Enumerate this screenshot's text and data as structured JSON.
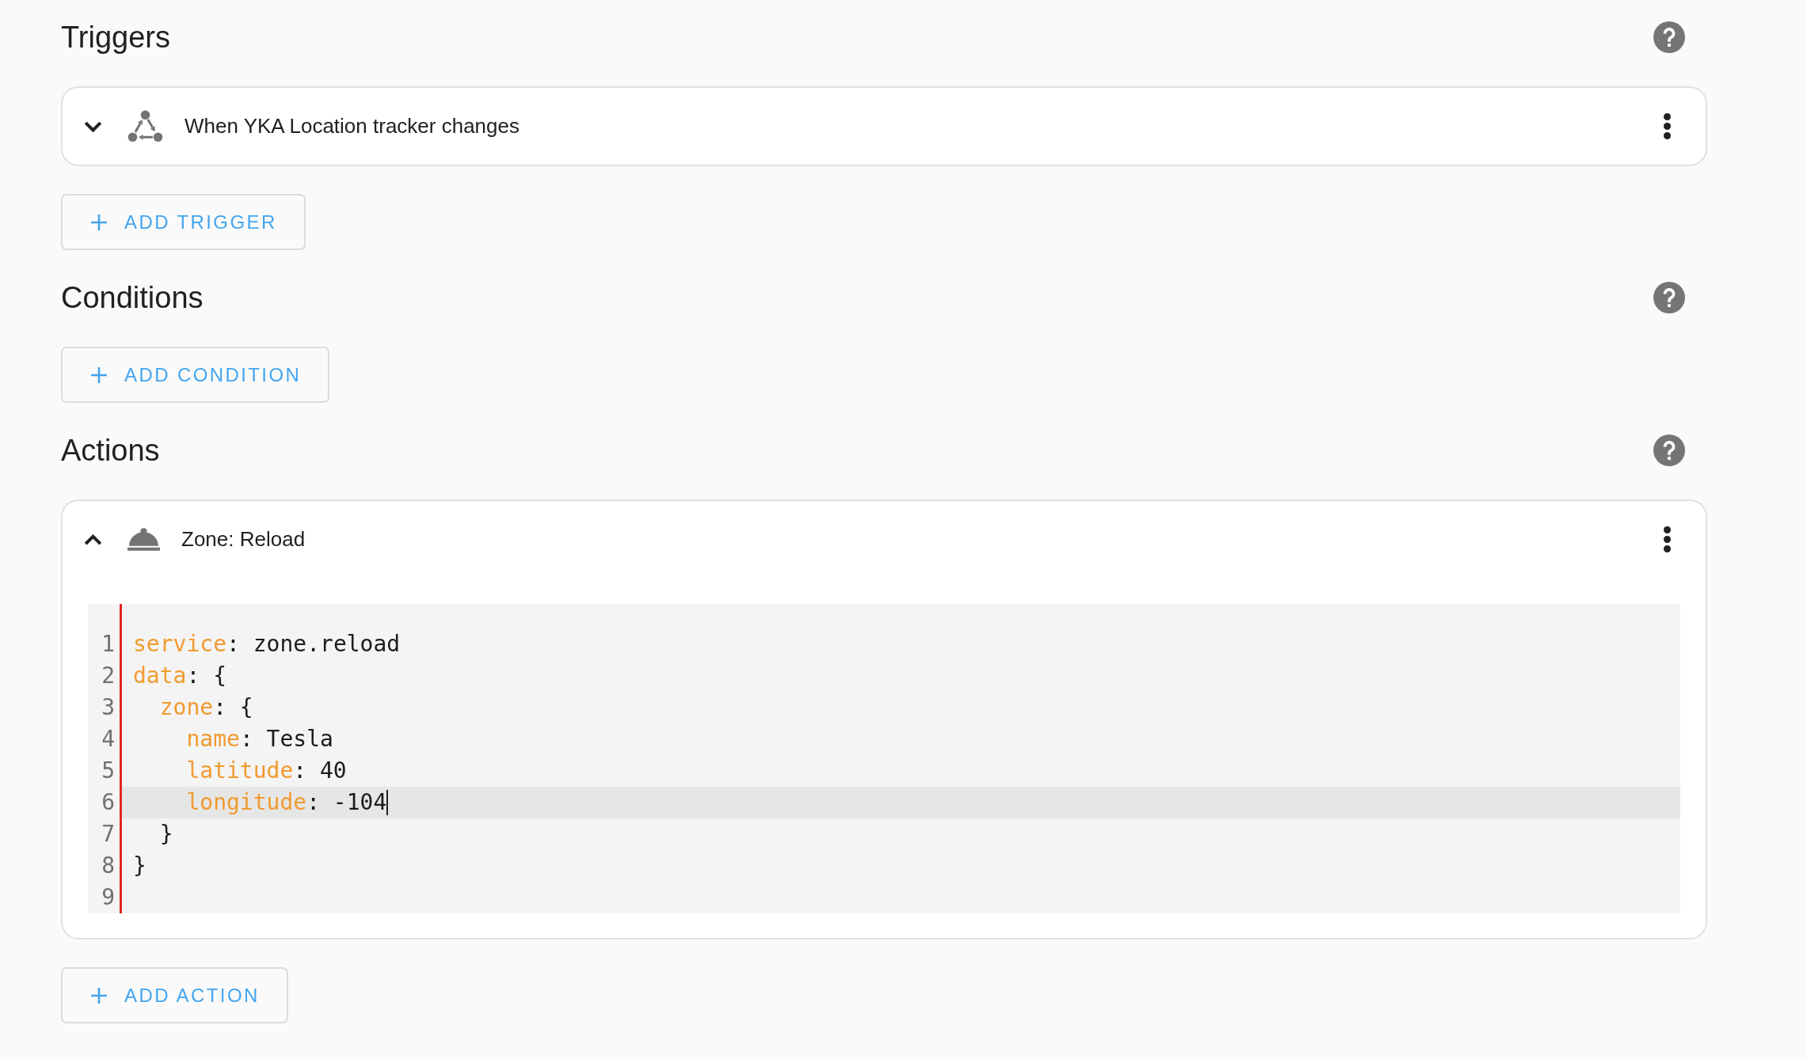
{
  "sections": [
    {
      "title": "Triggers",
      "items": [
        {
          "kind": "state",
          "title": "When YKA Location tracker changes",
          "expanded": false
        }
      ],
      "add_button": "ADD TRIGGER"
    },
    {
      "title": "Conditions",
      "add_button": "ADD CONDITION"
    },
    {
      "title": "Actions",
      "items": [
        {
          "kind": "service",
          "title": "Zone: Reload",
          "expanded": true,
          "editor": {
            "lines": [
              {
                "number": "1",
                "text": "service: zone.reload",
                "active": false
              },
              {
                "number": "2",
                "text": "data: {",
                "active": false
              },
              {
                "number": "3",
                "text": "  zone: {",
                "active": false
              },
              {
                "number": "4",
                "text": "    name: Tesla",
                "active": false
              },
              {
                "number": "5",
                "text": "    latitude: 40",
                "active": false
              },
              {
                "number": "6",
                "text": "    longitude: -104",
                "active": true
              },
              {
                "number": "7",
                "text": "  }",
                "active": false
              },
              {
                "number": "8",
                "text": "}",
                "active": false
              },
              {
                "number": "9",
                "active": false
              }
            ]
          }
        }
      ],
      "add_button": "ADD ACTION"
    }
  ]
}
